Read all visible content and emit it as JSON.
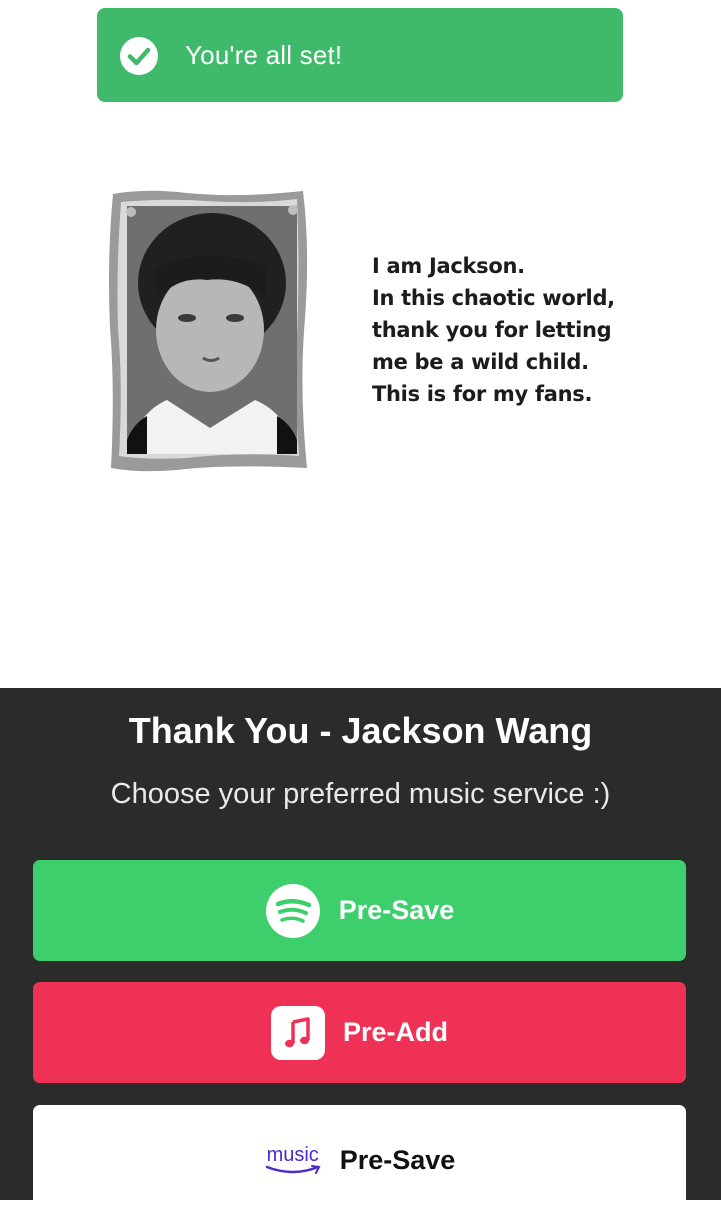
{
  "toast": {
    "message": "You're all set!",
    "icon": "check-circle-icon",
    "color": "#3fba6b"
  },
  "hero": {
    "photo_alt": "childhood photo",
    "quote_lines": [
      "I am Jackson.",
      "In this chaotic world,",
      "thank you for letting",
      "me be a wild child.",
      "This is for my fans."
    ]
  },
  "panel": {
    "title": "Thank You - Jackson Wang",
    "subtitle": "Choose your preferred music service :)",
    "services": [
      {
        "name": "Spotify",
        "icon": "spotify-icon",
        "label": "Pre-Save",
        "color": "#3ccf6c"
      },
      {
        "name": "Apple Music",
        "icon": "apple-music-icon",
        "label": "Pre-Add",
        "color": "#ef3156"
      },
      {
        "name": "Amazon Music",
        "icon": "amazon-music-icon",
        "logo_text": "music",
        "label": "Pre-Save",
        "color": "#ffffff"
      }
    ]
  }
}
